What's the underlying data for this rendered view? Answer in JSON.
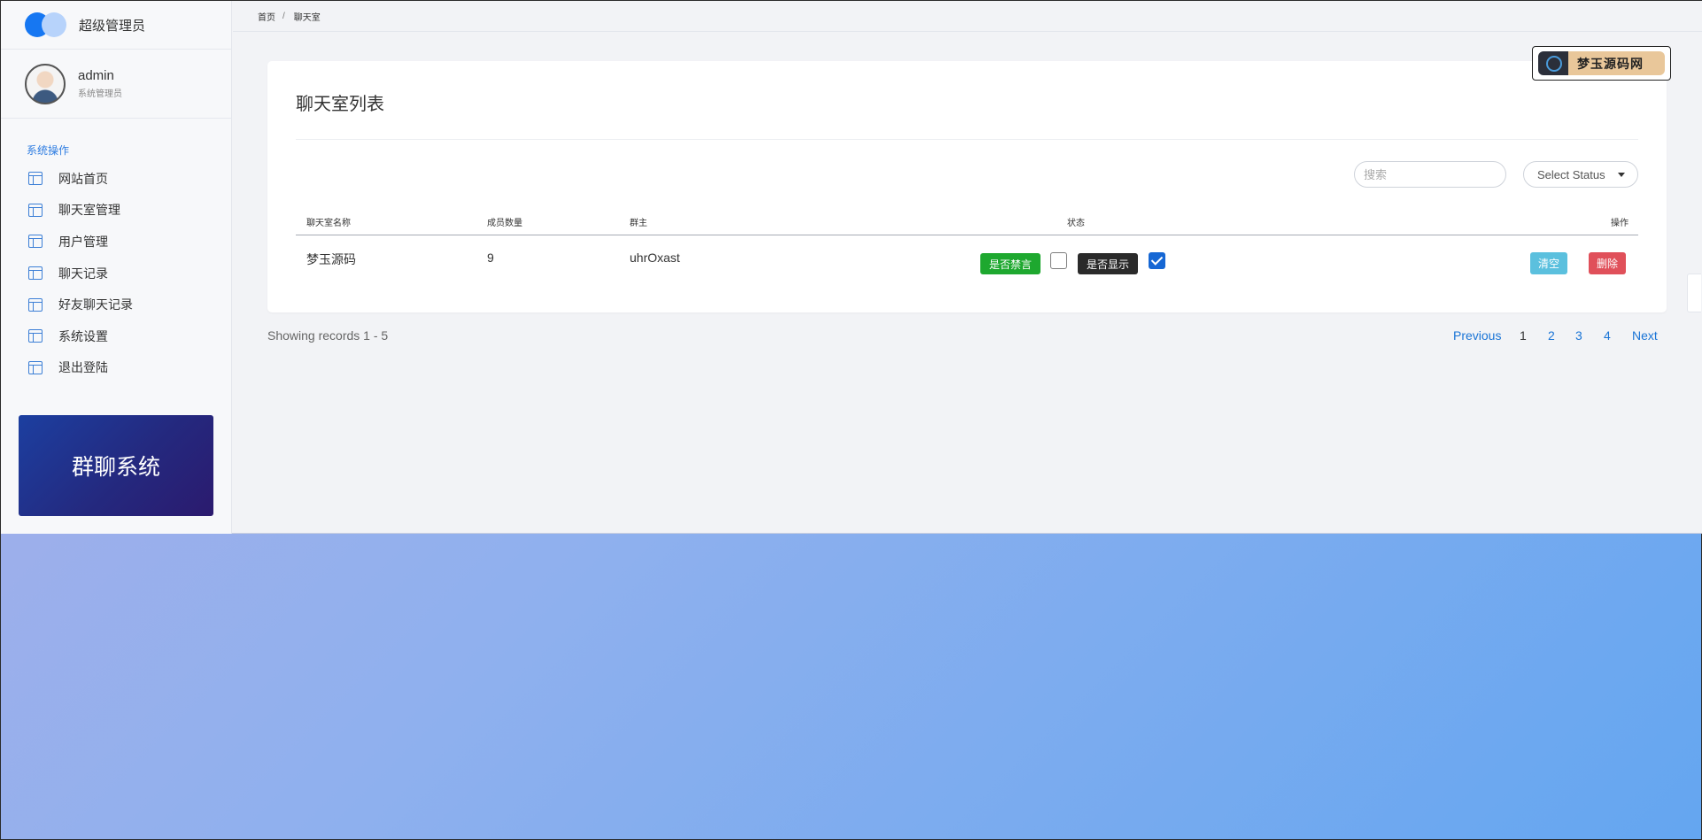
{
  "sidebar": {
    "brand_title": "超级管理员",
    "profile": {
      "name": "admin",
      "role": "系统管理员"
    },
    "section_label": "系统操作",
    "items": [
      {
        "label": "网站首页",
        "icon": "layout-icon"
      },
      {
        "label": "聊天室管理",
        "icon": "layout-icon"
      },
      {
        "label": "用户管理",
        "icon": "layout-icon"
      },
      {
        "label": "聊天记录",
        "icon": "layout-icon"
      },
      {
        "label": "好友聊天记录",
        "icon": "layout-icon"
      },
      {
        "label": "系统设置",
        "icon": "layout-icon"
      },
      {
        "label": "退出登陆",
        "icon": "layout-icon"
      }
    ],
    "promo_text": "群聊系统"
  },
  "breadcrumb": {
    "home": "首页",
    "separator": "/",
    "current": "聊天室"
  },
  "card": {
    "title": "聊天室列表",
    "search": {
      "placeholder": "搜索",
      "value": ""
    },
    "status_select": {
      "selected": "Select Status"
    },
    "table": {
      "headers": {
        "name": "聊天室名称",
        "members": "成员数量",
        "owner": "群主",
        "status": "状态",
        "actions": "操作"
      },
      "rows": [
        {
          "name": "梦玉源码",
          "members": "9",
          "owner": "uhrOxast",
          "mute_label": "是否禁言",
          "mute_checked": false,
          "show_label": "是否显示",
          "show_checked": true,
          "clear_label": "清空",
          "delete_label": "删除"
        }
      ]
    }
  },
  "pagination": {
    "records_text": "Showing records 1 - 5",
    "previous": "Previous",
    "pages": [
      "1",
      "2",
      "3",
      "4"
    ],
    "current_page": "1",
    "next": "Next"
  },
  "watermark_text": "梦玉源码网",
  "colors": {
    "accent": "#1677f2",
    "success": "#1ea82f",
    "info": "#5bc0de",
    "danger": "#e0505a",
    "checkbox_checked": "#1667d4"
  }
}
